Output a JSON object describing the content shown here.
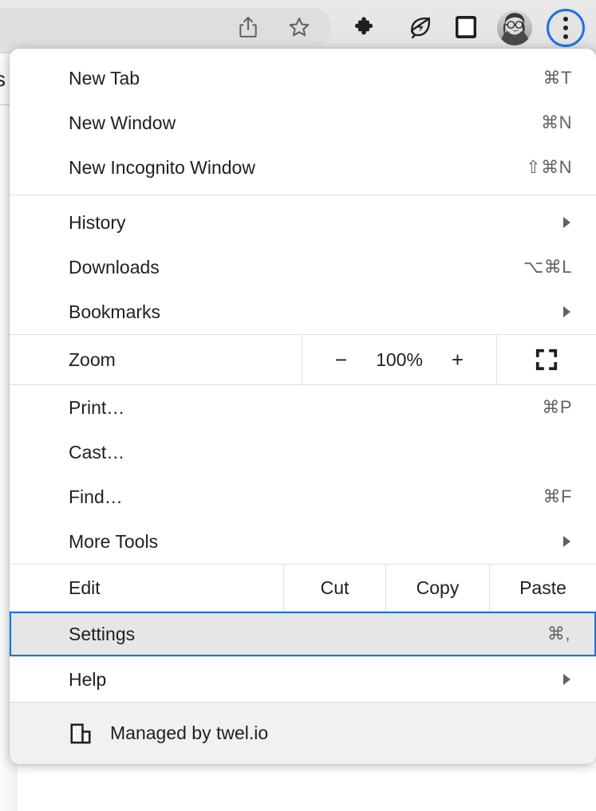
{
  "toolbar": {
    "icons": [
      {
        "name": "share-icon",
        "label": "Share"
      },
      {
        "name": "bookmark-star-icon",
        "label": "Bookmark this tab"
      },
      {
        "name": "extensions-puzzle-icon",
        "label": "Extensions"
      },
      {
        "name": "energy-saver-leaf-icon",
        "label": "Performance"
      },
      {
        "name": "side-panel-icon",
        "label": "Side panel"
      }
    ],
    "avatar_label": "Profile",
    "menu_button_label": "Customize and control Google Chrome",
    "focus_ring_color": "#1a73e8"
  },
  "page_fragment_text": "s",
  "menu": {
    "groups": [
      {
        "items": [
          {
            "label": "New Tab",
            "accel": "⌘T",
            "arrow": false
          },
          {
            "label": "New Window",
            "accel": "⌘N",
            "arrow": false
          },
          {
            "label": "New Incognito Window",
            "accel": "⇧⌘N",
            "arrow": false
          }
        ]
      },
      {
        "items": [
          {
            "label": "History",
            "accel": "",
            "arrow": true
          },
          {
            "label": "Downloads",
            "accel": "⌥⌘L",
            "arrow": false
          },
          {
            "label": "Bookmarks",
            "accel": "",
            "arrow": true
          }
        ]
      }
    ],
    "zoom": {
      "label": "Zoom",
      "minus": "−",
      "level": "100%",
      "plus": "+",
      "fullscreen_icon": "fullscreen-icon"
    },
    "tools_group": [
      {
        "label": "Print…",
        "accel": "⌘P",
        "arrow": false
      },
      {
        "label": "Cast…",
        "accel": "",
        "arrow": false
      },
      {
        "label": "Find…",
        "accel": "⌘F",
        "arrow": false
      },
      {
        "label": "More Tools",
        "accel": "",
        "arrow": true
      }
    ],
    "edit": {
      "label": "Edit",
      "cut": "Cut",
      "copy": "Copy",
      "paste": "Paste"
    },
    "settings": {
      "label": "Settings",
      "accel": "⌘,"
    },
    "help": {
      "label": "Help",
      "accel": "",
      "arrow": true
    },
    "footer": {
      "icon": "enterprise-building-icon",
      "text": "Managed by twel.io"
    },
    "selected_item": "Settings",
    "selection_border_color": "#1a73e8",
    "selection_bg_color": "#e6e6e6"
  }
}
